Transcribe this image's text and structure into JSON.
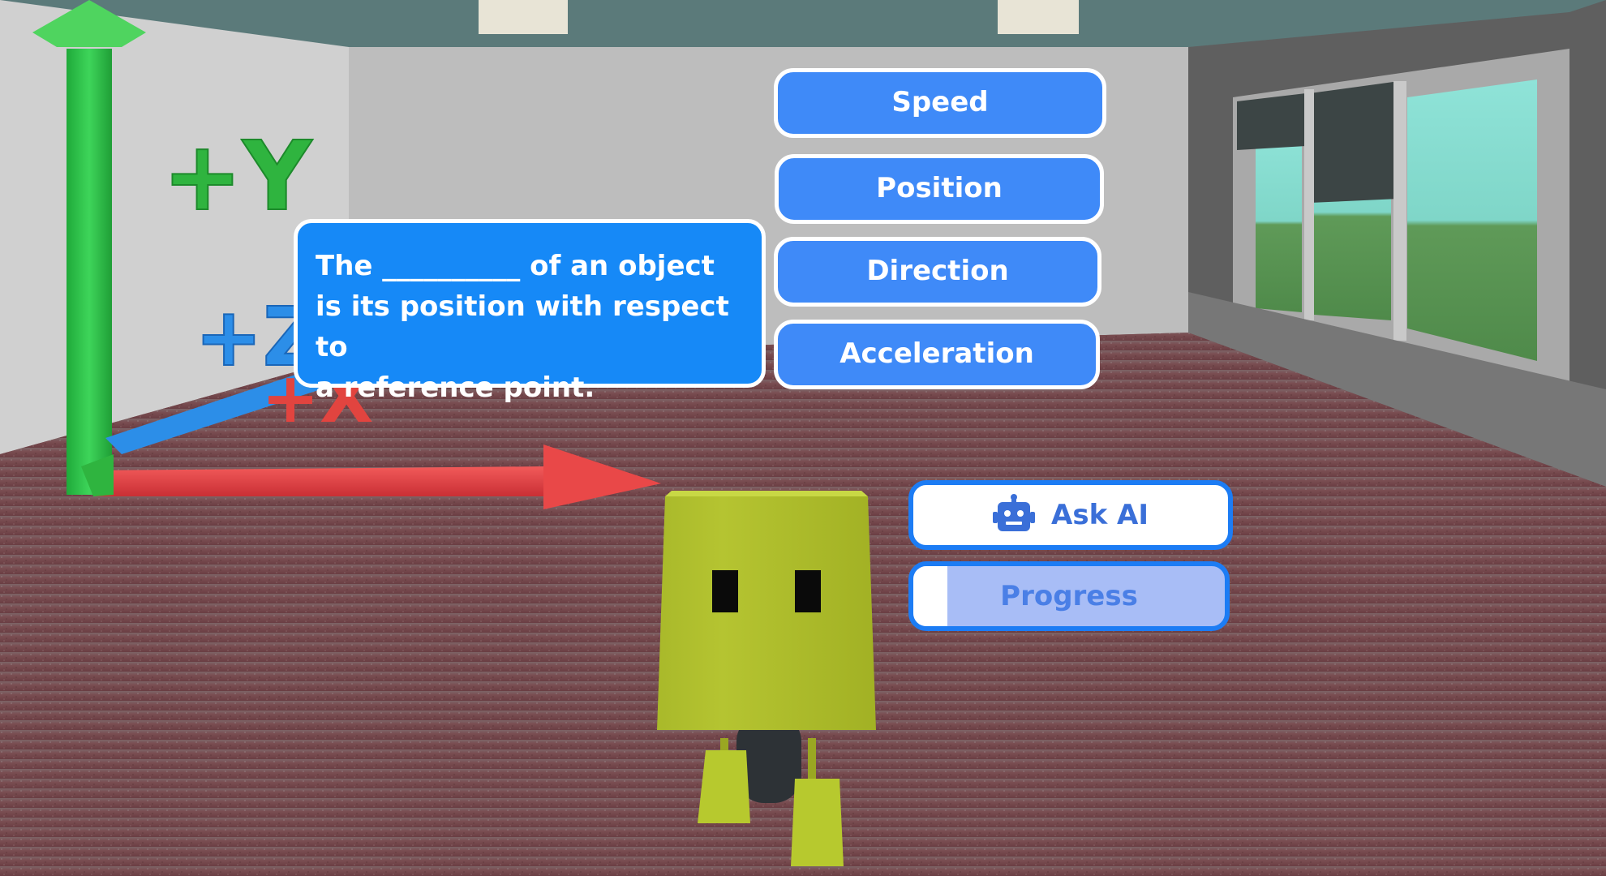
{
  "scene": {
    "axis_labels": {
      "y": "+Y",
      "z": "+Z",
      "x": "+X"
    }
  },
  "question": {
    "text": "The __________ of an object\nis its position with respect to\na reference point."
  },
  "answers": [
    {
      "label": "Speed"
    },
    {
      "label": "Position"
    },
    {
      "label": "Direction"
    },
    {
      "label": "Acceleration"
    }
  ],
  "ask_ai": {
    "label": "Ask AI",
    "icon": "robot-icon"
  },
  "progress": {
    "label": "Progress",
    "fraction": 0.11
  },
  "colors": {
    "button_blue": "#3f8af8",
    "bubble_blue": "#1689f7",
    "outline_blue": "#1c7cf4",
    "progress_track": "#a8bdf6"
  }
}
